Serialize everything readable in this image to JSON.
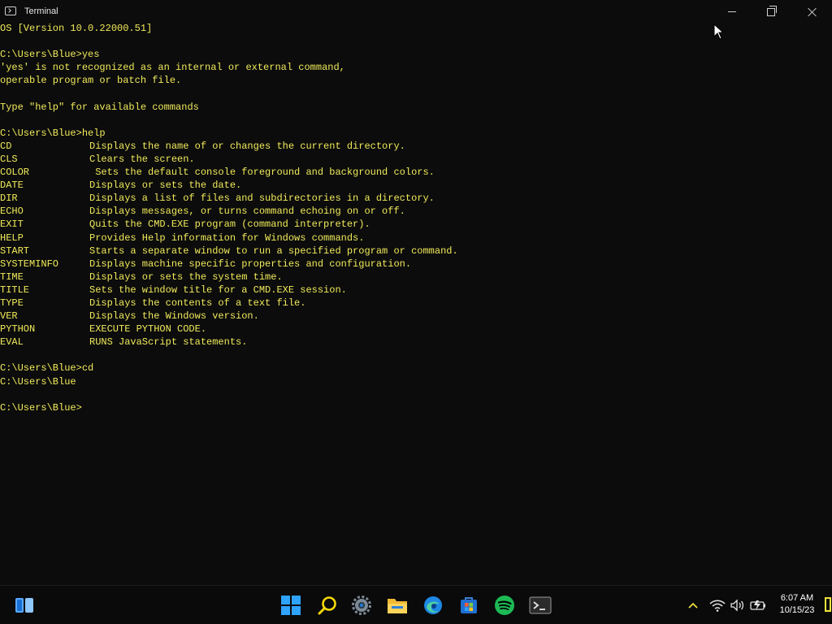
{
  "window": {
    "title": "Terminal"
  },
  "console": {
    "lines_top": [
      "OS [Version 10.0.22000.51]",
      "",
      "C:\\Users\\Blue>yes",
      "'yes' is not recognized as an internal or external command,",
      "operable program or batch file.",
      "",
      "Type \"help\" for available commands",
      "",
      "C:\\Users\\Blue>help"
    ],
    "help": [
      {
        "cmd": "CD",
        "desc": "Displays the name of or changes the current directory."
      },
      {
        "cmd": "CLS",
        "desc": "Clears the screen."
      },
      {
        "cmd": "COLOR",
        "desc": " Sets the default console foreground and background colors."
      },
      {
        "cmd": "DATE",
        "desc": "Displays or sets the date."
      },
      {
        "cmd": "DIR",
        "desc": "Displays a list of files and subdirectories in a directory."
      },
      {
        "cmd": "ECHO",
        "desc": "Displays messages, or turns command echoing on or off."
      },
      {
        "cmd": "EXIT",
        "desc": "Quits the CMD.EXE program (command interpreter)."
      },
      {
        "cmd": "HELP",
        "desc": "Provides Help information for Windows commands."
      },
      {
        "cmd": "START",
        "desc": "Starts a separate window to run a specified program or command."
      },
      {
        "cmd": "SYSTEMINFO",
        "desc": "Displays machine specific properties and configuration."
      },
      {
        "cmd": "TIME",
        "desc": "Displays or sets the system time."
      },
      {
        "cmd": "TITLE",
        "desc": "Sets the window title for a CMD.EXE session."
      },
      {
        "cmd": "TYPE",
        "desc": "Displays the contents of a text file."
      },
      {
        "cmd": "VER",
        "desc": "Displays the Windows version."
      },
      {
        "cmd": "PYTHON",
        "desc": "EXECUTE PYTHON CODE."
      },
      {
        "cmd": "EVAL",
        "desc": "RUNS JavaScript statements."
      }
    ],
    "lines_bottom": [
      "",
      "C:\\Users\\Blue>cd",
      "C:\\Users\\Blue",
      "",
      "C:\\Users\\Blue>"
    ],
    "text_color": "#f0ea5a"
  },
  "taskbar": {
    "apps": [
      {
        "name": "widgets-icon"
      },
      {
        "name": "start-icon"
      },
      {
        "name": "search-icon"
      },
      {
        "name": "settings-icon"
      },
      {
        "name": "file-explorer-icon"
      },
      {
        "name": "edge-icon"
      },
      {
        "name": "store-icon"
      },
      {
        "name": "spotify-icon"
      },
      {
        "name": "terminal-icon"
      }
    ],
    "tray": {
      "time": "6:07 AM",
      "date": "10/15/23"
    }
  }
}
